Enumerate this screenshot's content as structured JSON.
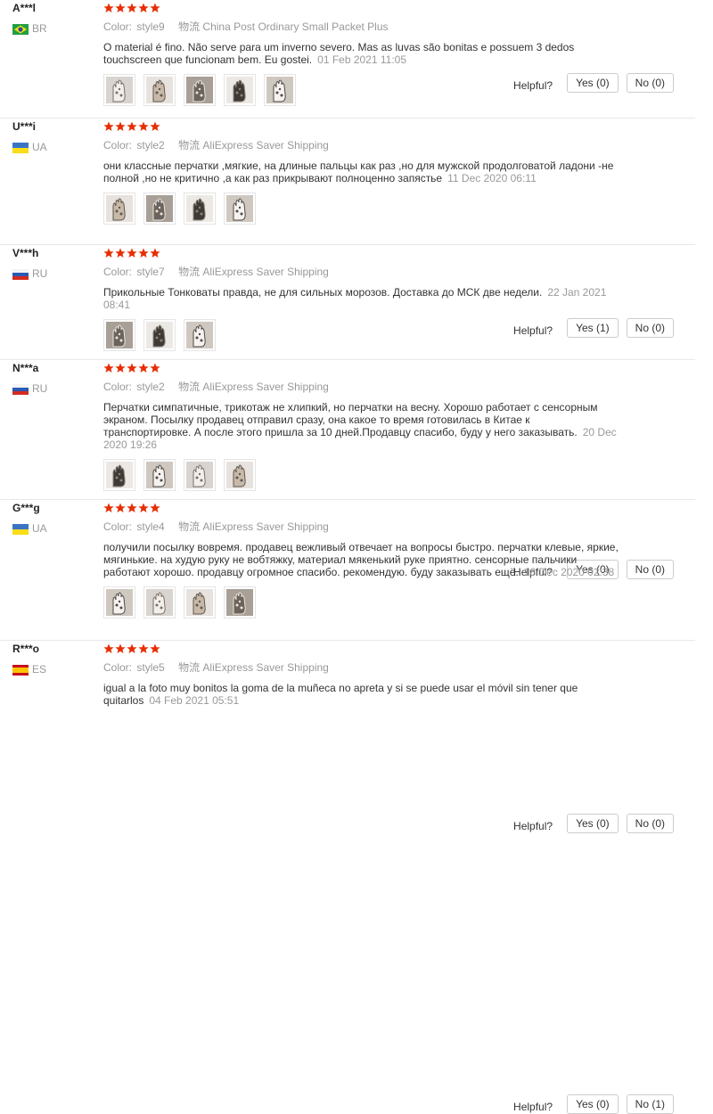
{
  "ui": {
    "helpful_label": "Helpful?",
    "color_label": "Color:",
    "shipping_label": "物流"
  },
  "reviews": [
    {
      "user": "A***l",
      "country": "BR",
      "color": "style9",
      "shipping": "China Post Ordinary Small Packet Plus",
      "text": "O material é fino. Não serve para um inverno severo. Mas as luvas são bonitas e possuem 3 dedos touchscreen que funcionam bem. Eu gostei.",
      "date": "01 Feb 2021 11:05",
      "yes": "Yes (0)",
      "no": "No (0)",
      "stars": 5,
      "photos": 5
    },
    {
      "user": "U***i",
      "country": "UA",
      "color": "style2",
      "shipping": "AliExpress Saver Shipping",
      "text": "они классные перчатки ,мягкие, на длиные пальцы как раз ,но для мужской продолговатой ладони -не полной ,но не критично ,а как раз прикрывают полноценно запястье",
      "date": "11 Dec 2020 06:11",
      "yes": "Yes (1)",
      "no": "No (0)",
      "stars": 5,
      "photos": 4
    },
    {
      "user": "V***h",
      "country": "RU",
      "color": "style7",
      "shipping": "AliExpress Saver Shipping",
      "text": "Прикольные Тонковаты правда, не для сильных морозов. Доставка до МСК две недели.",
      "date": "22 Jan 2021 08:41",
      "yes": "Yes (0)",
      "no": "No (0)",
      "stars": 5,
      "photos": 3
    },
    {
      "user": "N***a",
      "country": "RU",
      "color": "style2",
      "shipping": "AliExpress Saver Shipping",
      "text": "Перчатки симпатичные, трикотаж не хлипкий, но перчатки на весну. Хорошо работает с сенсорным экраном. Посылку продавец отправил сразу, она какое то время готовилась в Китае к транспортировке. А после этого пришла за 10 дней.Продавцу спасибо, буду у него заказывать.",
      "date": "20 Dec 2020 19:26",
      "yes": "Yes (0)",
      "no": "No (0)",
      "stars": 5,
      "photos": 4
    },
    {
      "user": "G***g",
      "country": "UA",
      "color": "style4",
      "shipping": "AliExpress Saver Shipping",
      "text": "получили посылку вовремя. продавец вежливый отвечает на вопросы быстро. перчатки клевые, яркие, мягинькие. на худую руку не вобтяжку, материал мякенький руке приятно. сенсорные пальчики работают хорошо. продавцу огромное спасибо. рекомендую. буду заказывать ещё.",
      "date": "18 Dec 2020 02:38",
      "yes": "Yes (0)",
      "no": "No (1)",
      "stars": 5,
      "photos": 4
    },
    {
      "user": "R***o",
      "country": "ES",
      "color": "style5",
      "shipping": "AliExpress Saver Shipping",
      "text": "igual a la foto muy bonitos la goma de la muñeca no apreta y si se puede usar el móvil sin tener que quitarlos",
      "date": "04 Feb 2021 05:51",
      "yes": "Yes (0)",
      "no": "No (0)",
      "stars": 5,
      "photos": 0
    }
  ],
  "colors": {
    "star": "#e62e04",
    "border": "#e8e8e8",
    "muted": "#999999"
  }
}
